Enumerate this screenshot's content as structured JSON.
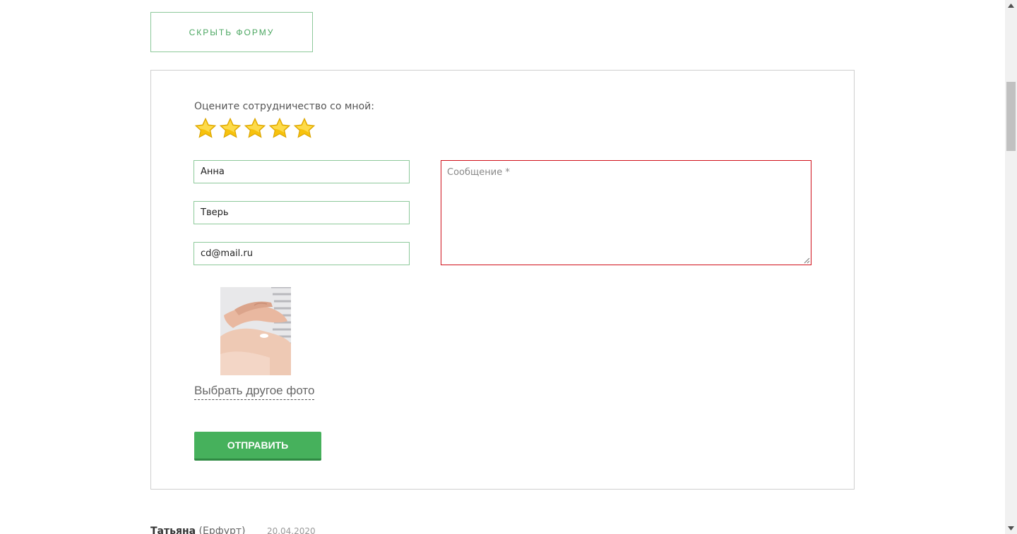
{
  "form_toggle": {
    "hide_label": "СКРЫТЬ ФОРМУ"
  },
  "review_form": {
    "rating_label": "Оцените сотрудничество со мной:",
    "rating": {
      "value": 5,
      "max": 5
    },
    "name_value": "Анна",
    "city_value": "Тверь",
    "email_value": "cd@mail.ru",
    "message_placeholder": "Сообщение *",
    "change_photo_label": "Выбрать другое фото",
    "submit_label": "ОТПРАВИТЬ"
  },
  "review_preview": {
    "author": "Татьяна",
    "city": "(Ерфурт)",
    "date": "20.04.2020"
  },
  "colors": {
    "accent_green": "#46b15c",
    "field_border": "#8dc99a",
    "error_border": "#d0101a",
    "star": "#f7c20c"
  }
}
